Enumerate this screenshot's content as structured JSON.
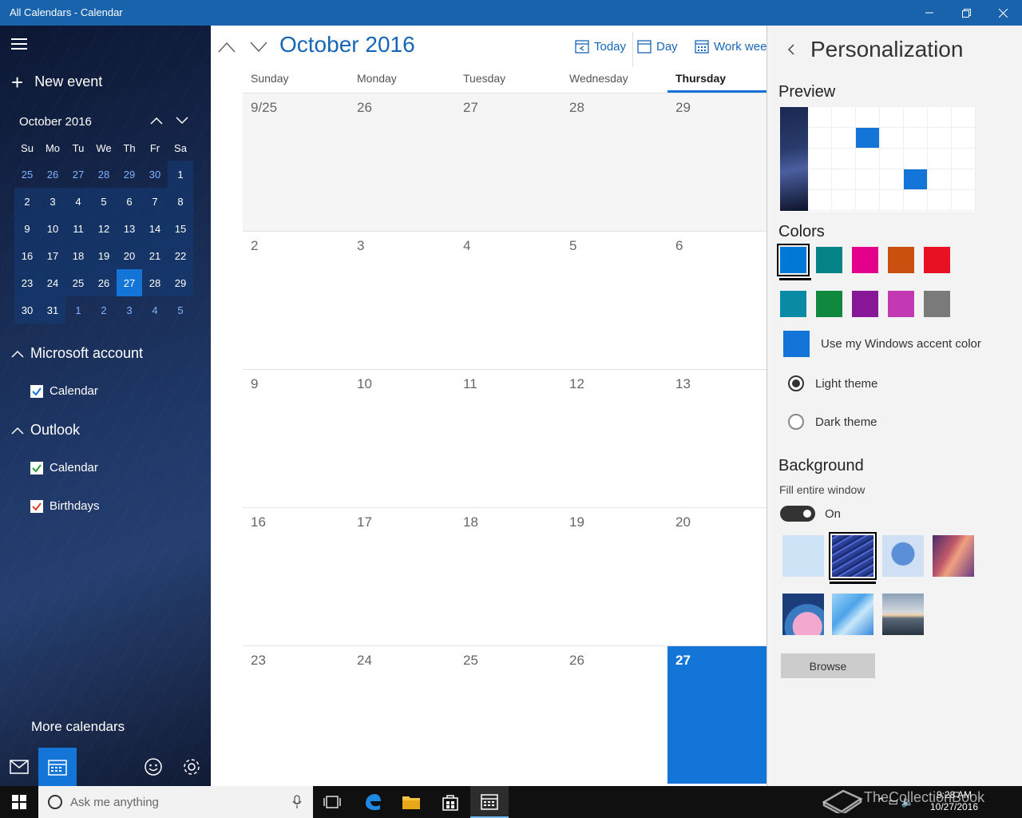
{
  "window": {
    "title": "All Calendars - Calendar"
  },
  "sidebar": {
    "new_event": "New event",
    "mini_calendar": {
      "month_label": "October 2016",
      "dow": [
        "Su",
        "Mo",
        "Tu",
        "We",
        "Th",
        "Fr",
        "Sa"
      ],
      "days": [
        "25",
        "26",
        "27",
        "28",
        "29",
        "30",
        "1",
        "2",
        "3",
        "4",
        "5",
        "6",
        "7",
        "8",
        "9",
        "10",
        "11",
        "12",
        "13",
        "14",
        "15",
        "16",
        "17",
        "18",
        "19",
        "20",
        "21",
        "22",
        "23",
        "24",
        "25",
        "26",
        "27",
        "28",
        "29",
        "30",
        "31",
        "1",
        "2",
        "3",
        "4",
        "5"
      ]
    },
    "accounts": [
      {
        "name": "Microsoft account",
        "calendars": [
          {
            "label": "Calendar",
            "checked": true,
            "color": "#1375d8"
          }
        ]
      },
      {
        "name": "Outlook",
        "calendars": [
          {
            "label": "Calendar",
            "checked": true,
            "color": "#2f9a3a"
          },
          {
            "label": "Birthdays",
            "checked": true,
            "color": "#d9412b"
          }
        ]
      }
    ],
    "more_calendars": "More calendars",
    "bottom_icons": [
      "mail-icon",
      "calendar-icon",
      "feedback-smile-icon",
      "settings-gear-icon"
    ]
  },
  "main": {
    "month_title": "October 2016",
    "toolbar": {
      "today": "Today",
      "day": "Day",
      "work_week": "Work week"
    },
    "weekdays": [
      "Sunday",
      "Monday",
      "Tuesday",
      "Wednesday",
      "Thursday"
    ],
    "weeks": [
      [
        "9/25",
        "26",
        "27",
        "28",
        "29"
      ],
      [
        "2",
        "3",
        "4",
        "5",
        "6"
      ],
      [
        "9",
        "10",
        "11",
        "12",
        "13"
      ],
      [
        "16",
        "17",
        "18",
        "19",
        "20"
      ],
      [
        "23",
        "24",
        "25",
        "26",
        "27"
      ]
    ]
  },
  "personalization": {
    "title": "Personalization",
    "preview_heading": "Preview",
    "colors_heading": "Colors",
    "colors": [
      "#0078d7",
      "#038387",
      "#e3008c",
      "#ca5010",
      "#e81123",
      "#0b8aa6",
      "#10893e",
      "#881798",
      "#c239b3",
      "#7a7a7a"
    ],
    "selected_color": "#0078d7",
    "accent_label": "Use my Windows accent color",
    "light_theme": "Light theme",
    "dark_theme": "Dark theme",
    "theme_selected": "Light theme",
    "background_heading": "Background",
    "fill_label": "Fill entire window",
    "fill_state": "On",
    "backgrounds": [
      "plain-light-blue",
      "star-trails",
      "blue-tree",
      "canyon",
      "colorful-hills",
      "blue-polygons",
      "lake-sunset"
    ],
    "browse": "Browse"
  },
  "taskbar": {
    "search_placeholder": "Ask me anything",
    "time": "9:28 AM",
    "date": "10/27/2016",
    "watermark": "TheCollectionBook"
  }
}
